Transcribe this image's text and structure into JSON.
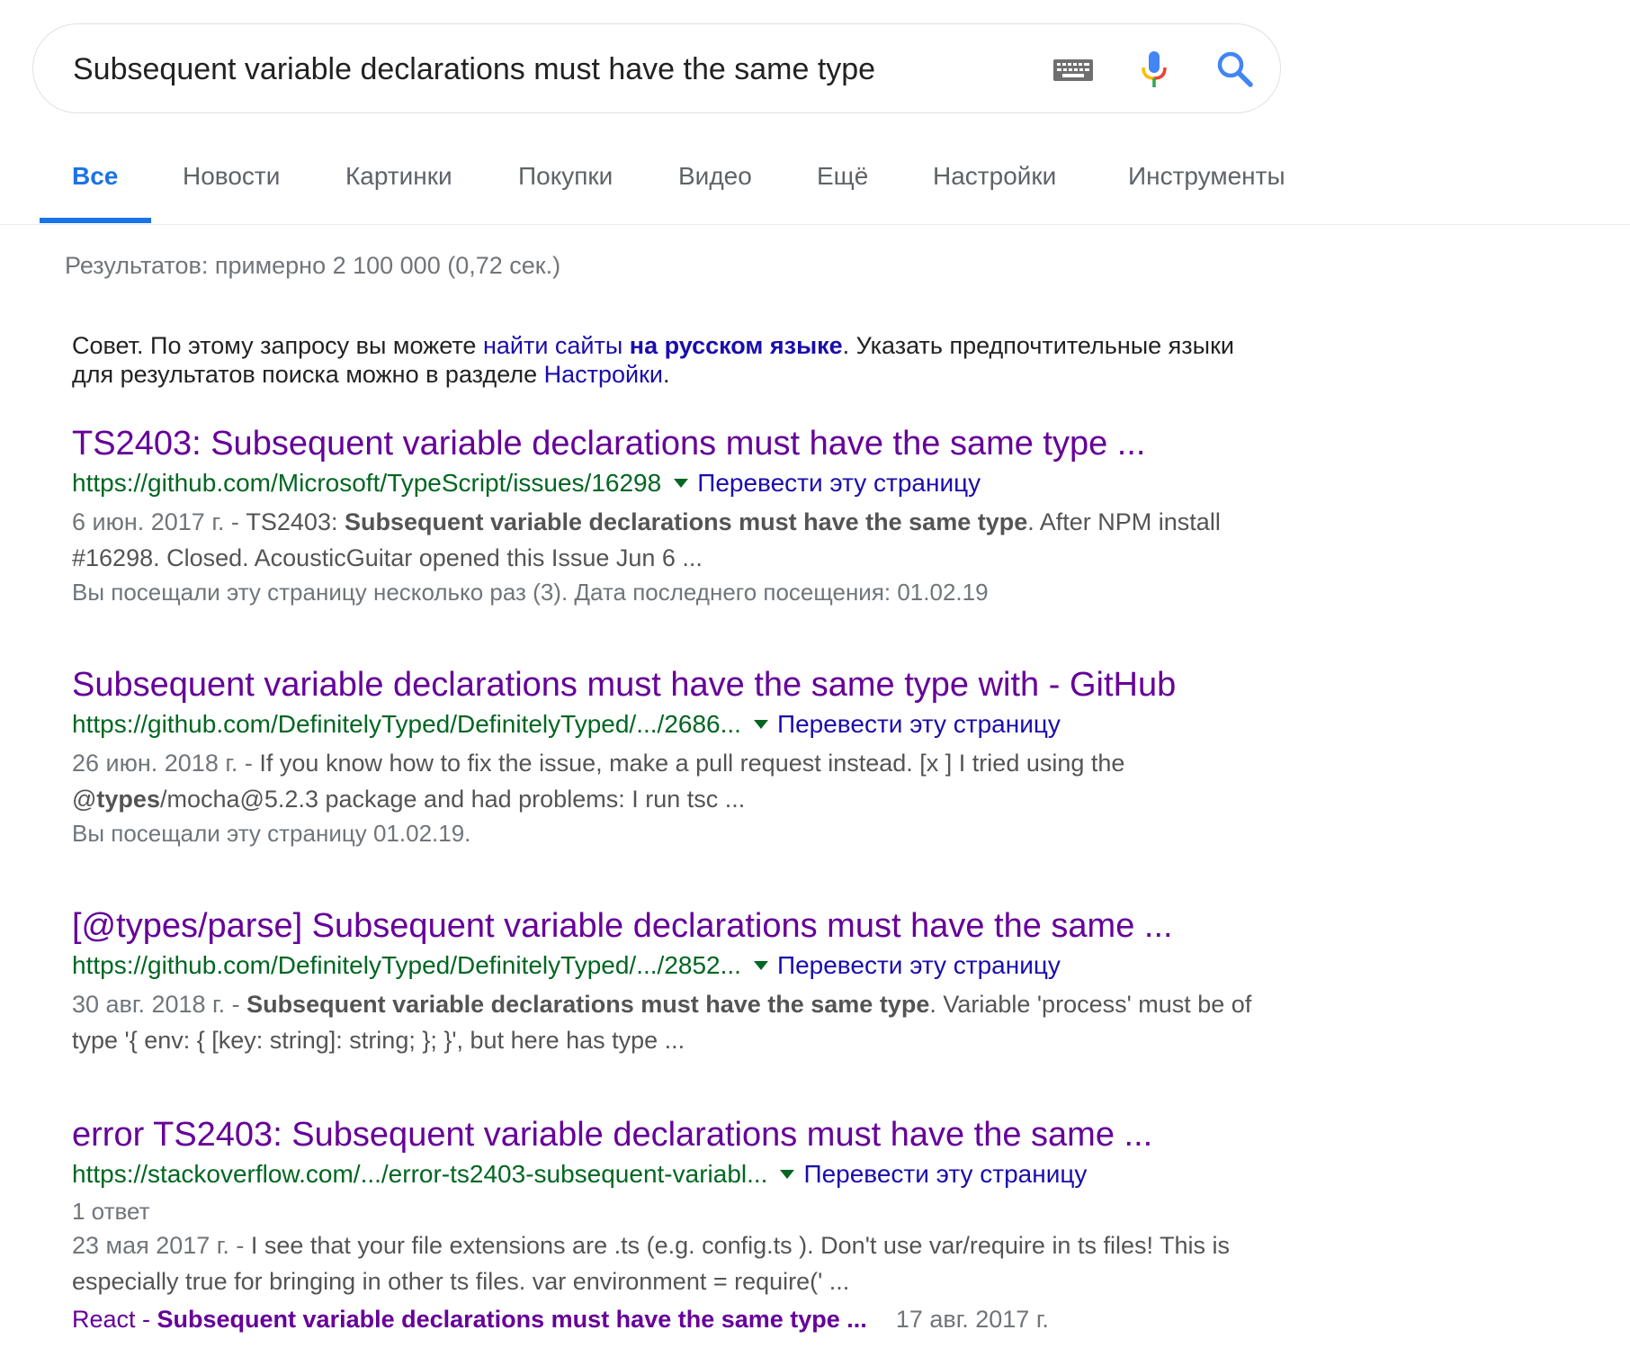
{
  "search": {
    "query": "Subsequent variable declarations must have the same type",
    "keyboard_icon": "keyboard-icon",
    "mic_icon": "mic-icon",
    "search_icon": "search-icon"
  },
  "colors": {
    "accent": "#1a73e8",
    "link_visited": "#660099",
    "link": "#1a0dab",
    "url_green": "#006621",
    "mic_blue": "#4285f4",
    "mic_red": "#ea4335",
    "mic_yellow": "#fbbc05",
    "mic_green": "#34a853"
  },
  "tabs": [
    {
      "label": "Все",
      "active": true
    },
    {
      "label": "Новости"
    },
    {
      "label": "Картинки"
    },
    {
      "label": "Покупки"
    },
    {
      "label": "Видео"
    },
    {
      "label": "Ещё"
    },
    {
      "label": "Настройки"
    },
    {
      "label": "Инструменты"
    }
  ],
  "stats": "Результатов: примерно 2 100 000 (0,72 сек.)",
  "tip": {
    "prefix": "Совет. По этому запросу вы можете ",
    "link1": "найти сайты ",
    "link1_bold": "на русском языке",
    "middle": ". Указать предпочтительные языки для результатов поиска можно в разделе ",
    "link2": "Настройки",
    "suffix": "."
  },
  "results": [
    {
      "title": "TS2403: Subsequent variable declarations must have the same type ...",
      "url": "https://github.com/Microsoft/TypeScript/issues/16298",
      "translate": "Перевести эту страницу",
      "date": "6 июн. 2017 г. - ",
      "s1": "TS2403: ",
      "s1_bold": "Subsequent variable declarations must have the same type",
      "s2": ". After NPM install #16298. Closed. AcousticGuitar opened this Issue Jun 6 ...",
      "visited": "Вы посещали эту страницу несколько раз (3). Дата последнего посещения: 01.02.19"
    },
    {
      "title": "Subsequent variable declarations must have the same type with - GitHub",
      "url": "https://github.com/DefinitelyTyped/DefinitelyTyped/.../2686...",
      "translate": "Перевести эту страницу",
      "date": "26 июн. 2018 г. - ",
      "s1": "If you know how to fix the issue, make a pull request instead. [x ] I tried using the @",
      "s1_bold": "types",
      "s2": "/mocha@5.2.3 package and had problems: I run tsc ...",
      "visited": "Вы посещали эту страницу 01.02.19."
    },
    {
      "title": "[@types/parse] Subsequent variable declarations must have the same ...",
      "url": "https://github.com/DefinitelyTyped/DefinitelyTyped/.../2852...",
      "translate": "Перевести эту страницу",
      "date": "30 авг. 2018 г. - ",
      "s1": "",
      "s1_bold": "Subsequent variable declarations must have the same type",
      "s2": ". Variable 'process' must be of type '{ env: { [key: string]: string; }; }', but here has type ...",
      "visited": ""
    },
    {
      "title": "error TS2403: Subsequent variable declarations must have the same ...",
      "url": "https://stackoverflow.com/.../error-ts2403-subsequent-variabl...",
      "translate": "Перевести эту страницу",
      "answers": "1 ответ",
      "date": "23 мая 2017 г. - ",
      "s1": "I see that your file extensions are .ts (e.g. config.ts ). Don't use var/require in ts files! This is especially true for bringing in other ts files. var environment = require(' ...",
      "s1_bold": "",
      "s2": "",
      "visited": "",
      "sublink": {
        "prefix": "React - ",
        "bold": "Subsequent variable declarations must have the same type ...",
        "date": "17 авг. 2017 г."
      }
    }
  ]
}
